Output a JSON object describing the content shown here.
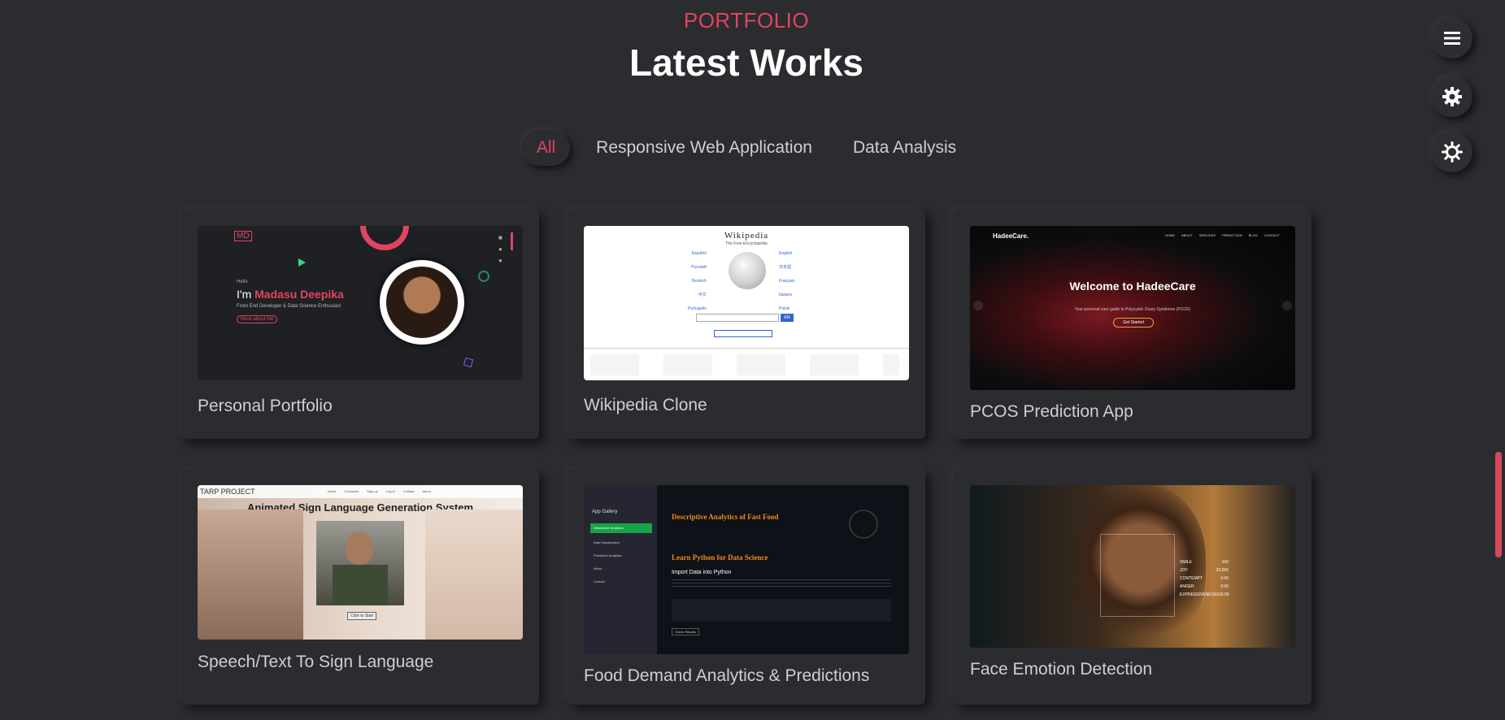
{
  "header": {
    "kicker": "PORTFOLIO",
    "title": "Latest Works"
  },
  "filters": [
    {
      "label": "All",
      "active": true
    },
    {
      "label": "Responsive Web Application",
      "active": false
    },
    {
      "label": "Data Analysis",
      "active": false
    }
  ],
  "side_buttons": [
    {
      "name": "menu-icon"
    },
    {
      "name": "settings-icon"
    },
    {
      "name": "theme-toggle-icon"
    }
  ],
  "accent_color": "#e0455f",
  "projects": [
    {
      "title": "Personal Portfolio",
      "thumb": {
        "badge": "MD",
        "hello": "Hello",
        "intro": "I'm ",
        "name": "Madasu Deepika",
        "tagline": "Front End Developer & Data Science Enthusiast",
        "cta": "More about Me"
      }
    },
    {
      "title": "Wikipedia Clone",
      "thumb": {
        "logo": "Wikipedia",
        "sub": "The Free Encyclopedia",
        "langs": [
          "Español",
          "English",
          "Русский",
          "日本語",
          "Deutsch",
          "Français",
          "中文",
          "Italiano",
          "Português",
          "Polski"
        ],
        "search_btn": "EN"
      }
    },
    {
      "title": "PCOS Prediction App",
      "thumb": {
        "brand": "HadeeCare.",
        "nav": [
          "HOME",
          "ABOUT",
          "SERVICES",
          "PREDICTION",
          "BLOG",
          "CONTACT"
        ],
        "headline": "Welcome to HadeeCare",
        "sub": "Your personal care guide to Polycystic Ovary Syndrome (PCOS)",
        "cta": "Get Started"
      }
    },
    {
      "title": "Speech/Text To Sign Language",
      "thumb": {
        "brand": "TARP PROJECT",
        "nav": [
          "Home",
          "Converter",
          "Sign up",
          "Log in",
          "Contact",
          "About"
        ],
        "headline": "Animated Sign Language Generation System",
        "btn": "Click to Start"
      }
    },
    {
      "title": "Food Demand Analytics & Predictions",
      "thumb": {
        "sidebar": [
          "App Gallery",
          "Descriptive Analytics",
          "Data Visualization",
          "Prediction Analytics",
          "About",
          "Contact"
        ],
        "h1": "Descriptive Analytics of Fast Food",
        "h2": "Learn Python for Data Science",
        "h3": "Import Data into Python",
        "btn": "Check Results"
      }
    },
    {
      "title": "Face Emotion Detection",
      "thumb": {
        "stats": [
          [
            "SMILE",
            "100"
          ],
          [
            "JOY",
            "23.055"
          ],
          [
            "CONTEMPT",
            "0.00"
          ],
          [
            "ANGER",
            "0.00"
          ],
          [
            "EXPRESSIVENESS",
            "100.00"
          ]
        ]
      }
    }
  ]
}
